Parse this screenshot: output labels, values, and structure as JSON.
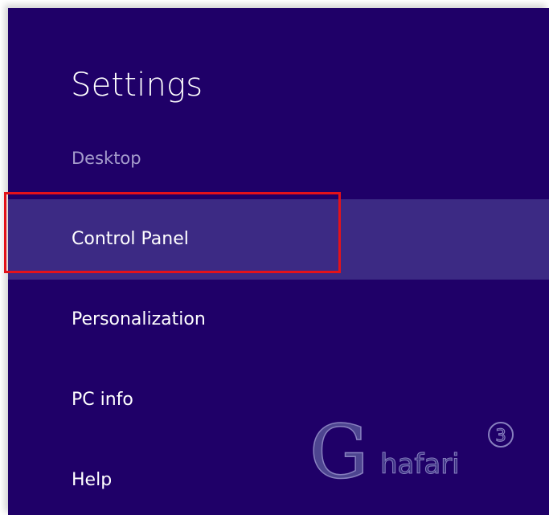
{
  "settings": {
    "title": "Settings",
    "subtitle": "Desktop",
    "items": [
      {
        "label": "Control Panel",
        "selected": true
      },
      {
        "label": "Personalization",
        "selected": false
      },
      {
        "label": "PC info",
        "selected": false
      },
      {
        "label": "Help",
        "selected": false
      }
    ]
  },
  "watermark": {
    "initial": "G",
    "text": "hafari",
    "badge": "3"
  },
  "colors": {
    "panel_background": "#1f0068",
    "selected_item_background": "#3c2a84",
    "subtitle_text": "#a59ccc",
    "highlight_border": "#e3121a"
  }
}
